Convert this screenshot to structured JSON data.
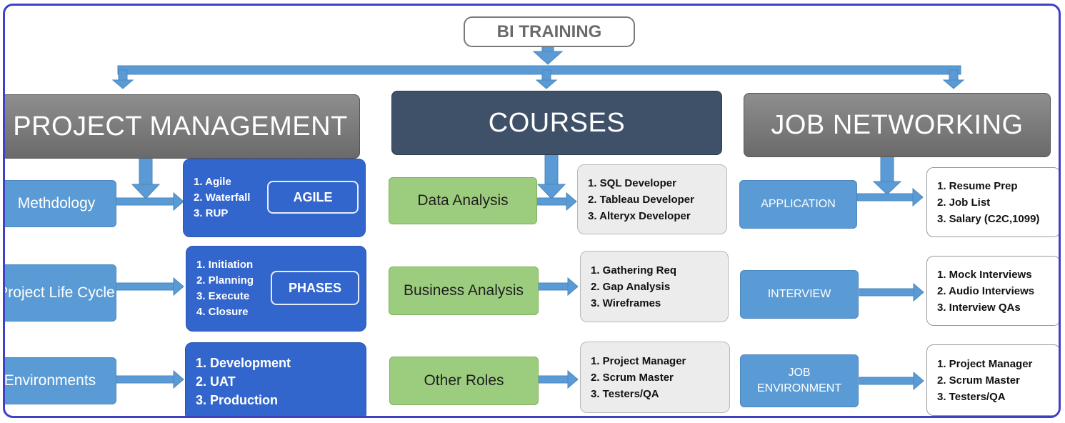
{
  "title": "BI TRAINING",
  "headers": {
    "project_management": "PROJECT MANAGEMENT",
    "courses": "COURSES",
    "job_networking": "JOB NETWORKING"
  },
  "project_management": {
    "rows": [
      {
        "label": "Methdology",
        "items": [
          "1. Agile",
          "2. Waterfall",
          "3. RUP"
        ],
        "tag": "AGILE"
      },
      {
        "label": "Project Life Cycle",
        "items": [
          "1. Initiation",
          "2. Planning",
          "3. Execute",
          "4. Closure"
        ],
        "tag": "PHASES"
      },
      {
        "label": "Environments",
        "items": [
          "1. Development",
          "2. UAT",
          "3. Production"
        ]
      }
    ]
  },
  "courses": {
    "rows": [
      {
        "label": "Data Analysis",
        "items": [
          "1. SQL Developer",
          "2. Tableau Developer",
          "3. Alteryx Developer"
        ]
      },
      {
        "label": "Business Analysis",
        "items": [
          "1. Gathering Req",
          "2. Gap Analysis",
          "3. Wireframes"
        ]
      },
      {
        "label": "Other Roles",
        "items": [
          "1. Project Manager",
          "2. Scrum Master",
          "3. Testers/QA"
        ]
      }
    ]
  },
  "job_networking": {
    "rows": [
      {
        "label": "APPLICATION",
        "items": [
          "1. Resume Prep",
          "2. Job List",
          "3. Salary (C2C,1099)"
        ]
      },
      {
        "label": "INTERVIEW",
        "items": [
          "1. Mock Interviews",
          "2. Audio Interviews",
          "3. Interview QAs"
        ]
      },
      {
        "label": "JOB ENVIRONMENT",
        "items": [
          "1. Project Manager",
          "2. Scrum Master",
          "3. Testers/QA"
        ]
      }
    ]
  },
  "colors": {
    "frame": "#3f3fc8",
    "connector": "#5b9bd5",
    "header_gray": "#7a7a7a",
    "header_navy": "#3f5169",
    "light_blue": "#5b9bd5",
    "dark_blue": "#3366cc",
    "green": "#9ccc7e",
    "list_gray": "#ececec"
  }
}
